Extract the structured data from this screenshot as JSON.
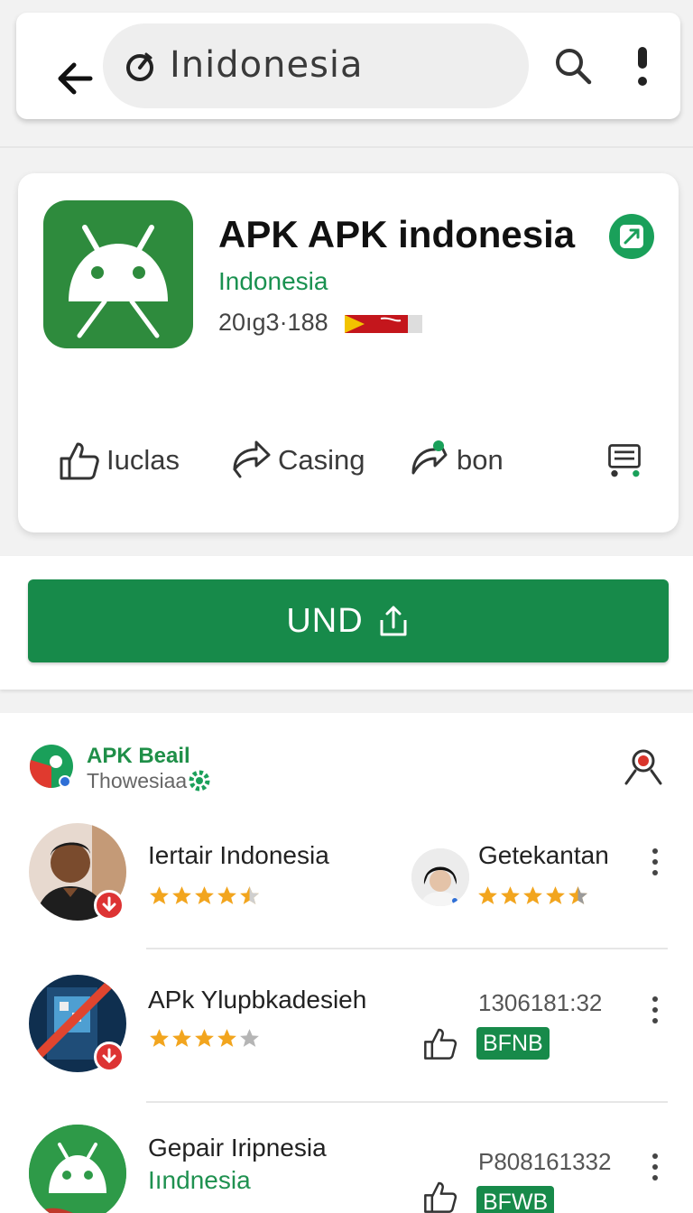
{
  "search": {
    "query": "Inidonesia"
  },
  "app": {
    "title": "APK APK indonesia",
    "developer": "Indonesia",
    "meta": "20ıg3·188"
  },
  "actions": [
    {
      "label": "Iuclas",
      "icon": "thumb-up-icon"
    },
    {
      "label": "Casing",
      "icon": "share-icon"
    },
    {
      "label": "bon",
      "icon": "share-badge-icon"
    },
    {
      "label": "",
      "icon": "cart-icon"
    }
  ],
  "install": {
    "label": "UND",
    "icon": "share-upload-icon"
  },
  "brand": {
    "name": "APK Beail",
    "subtitle": "Thowesiaa"
  },
  "list": [
    {
      "title": "Iertair Indonesia",
      "rating": 4.5,
      "right_title": "Getekantan",
      "right_rating": 4.5
    },
    {
      "title": "APk Ylupbkadesieh",
      "rating": 4,
      "number": "1306181:32",
      "tag": "BFNB"
    },
    {
      "title": "Gepair Iripnesia",
      "subtitle": "Iındnesia",
      "number": "P808161332",
      "tag": "BFWB"
    }
  ],
  "colors": {
    "accent": "#178a4a",
    "brand_green": "#1f8f48",
    "star": "#f2a51e"
  }
}
